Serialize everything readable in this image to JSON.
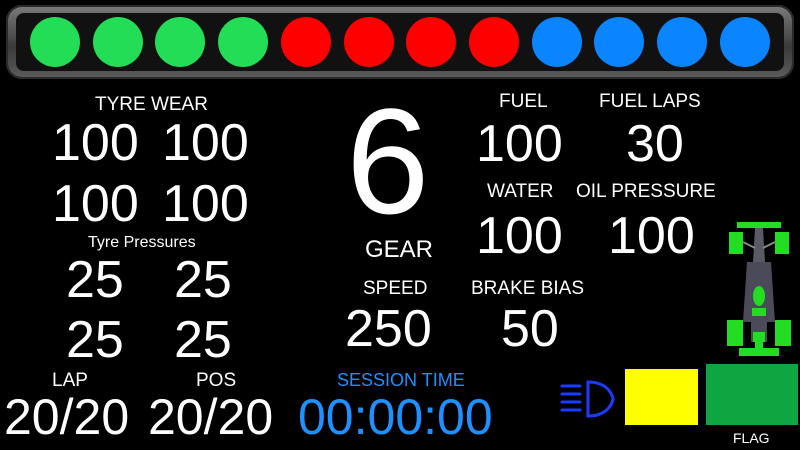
{
  "rev_lights": [
    {
      "color": "#22dd55"
    },
    {
      "color": "#22dd55"
    },
    {
      "color": "#22dd55"
    },
    {
      "color": "#22dd55"
    },
    {
      "color": "#ff0000"
    },
    {
      "color": "#ff0000"
    },
    {
      "color": "#ff0000"
    },
    {
      "color": "#ff0000"
    },
    {
      "color": "#0a84ff"
    },
    {
      "color": "#0a84ff"
    },
    {
      "color": "#0a84ff"
    },
    {
      "color": "#0a84ff"
    }
  ],
  "tyre_wear": {
    "label": "TYRE WEAR",
    "fl": "100",
    "fr": "100",
    "rl": "100",
    "rr": "100"
  },
  "tyre_pressures": {
    "label": "Tyre Pressures",
    "fl": "25",
    "fr": "25",
    "rl": "25",
    "rr": "25"
  },
  "gear": {
    "value": "6",
    "label": "GEAR"
  },
  "speed": {
    "label": "SPEED",
    "value": "250"
  },
  "brake_bias": {
    "label": "BRAKE BIAS",
    "value": "50"
  },
  "fuel": {
    "label": "FUEL",
    "value": "100"
  },
  "fuel_laps": {
    "label": "FUEL LAPS",
    "value": "30"
  },
  "water": {
    "label": "WATER",
    "value": "100"
  },
  "oil_pressure": {
    "label": "OIL PRESSURE",
    "value": "100"
  },
  "lap": {
    "label": "LAP",
    "value": "20/20"
  },
  "pos": {
    "label": "POS",
    "value": "20/20"
  },
  "session_time": {
    "label": "SESSION TIME",
    "value": "00:00:00",
    "color": "#1e90ff"
  },
  "indicators": {
    "headlight_icon": "headlight-icon",
    "headlight_color": "#1a3cff",
    "yellow_color": "#ffff00",
    "flag_color": "#0ea640",
    "flag_label": "FLAG",
    "car_icon": "car-damage-icon",
    "car_damage_color": "#22dd22"
  }
}
